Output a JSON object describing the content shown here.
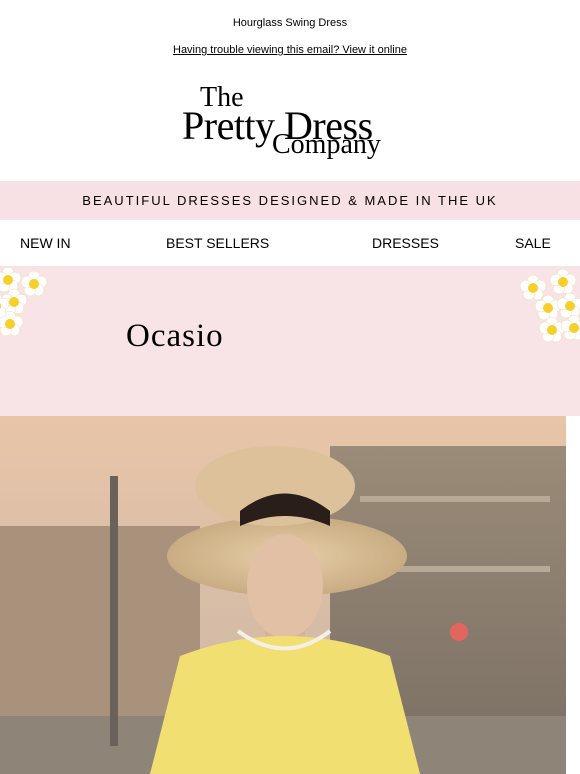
{
  "preheader": "Hourglass Swing Dress",
  "view_online": "Having trouble viewing this email? View it online",
  "logo": {
    "line1": "The",
    "line2": "Pretty Dress",
    "line3": "Company"
  },
  "banner": "BEAUTIFUL DRESSES DESIGNED & MADE IN THE UK",
  "nav": {
    "new_in": "NEW IN",
    "best_sellers": "BEST SELLERS",
    "dresses": "DRESSES",
    "sale": "SALE"
  },
  "hero": {
    "title": "Ocasio"
  },
  "colors": {
    "banner_bg": "#f7e1e4",
    "hero_bg": "#f8e4e7",
    "flower": "#f6cf2b"
  },
  "icons": [
    "flower-icon"
  ]
}
